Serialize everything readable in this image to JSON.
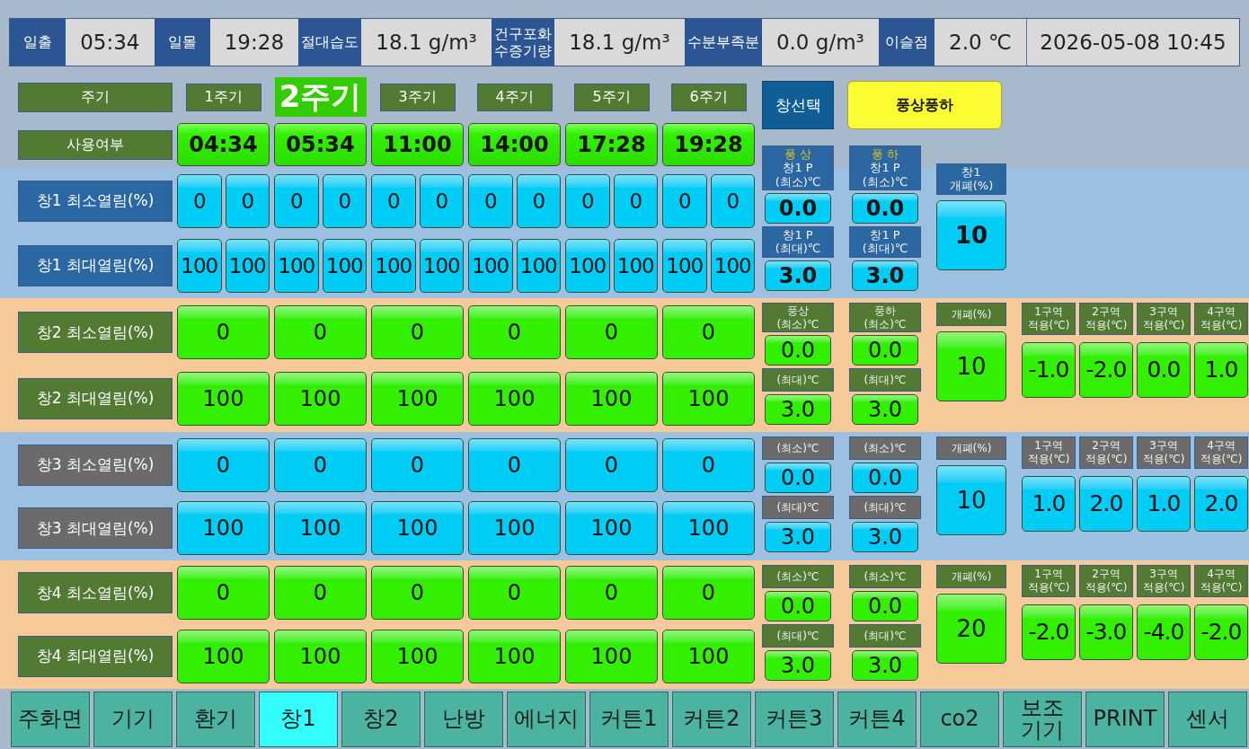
{
  "status_bar": {
    "items": [
      {
        "label": "일출",
        "value": "05:34"
      },
      {
        "label": "일몰",
        "value": "19:28"
      },
      {
        "label": "절대습도",
        "value": "18.1 g/m³"
      },
      {
        "label": "건구포화\n수증기량",
        "value": "18.1 g/m³"
      },
      {
        "label": "수분부족분",
        "value": "0.0 g/m³"
      },
      {
        "label": "이슬점",
        "value": "2.0 ℃"
      }
    ],
    "datetime": "2026-05-08 10:45"
  },
  "periods": {
    "header_label": "주기",
    "usage_label": "사용여부",
    "items": [
      {
        "label": "1주기",
        "time": "04:34",
        "selected": false
      },
      {
        "label": "2주기",
        "time": "05:34",
        "selected": true
      },
      {
        "label": "3주기",
        "time": "11:00",
        "selected": false
      },
      {
        "label": "4주기",
        "time": "14:00",
        "selected": false
      },
      {
        "label": "5주기",
        "time": "17:28",
        "selected": false
      },
      {
        "label": "6주기",
        "time": "19:28",
        "selected": false
      }
    ]
  },
  "window_select_button": "창선택",
  "wind_side_button": "풍상풍하",
  "windows": [
    {
      "kind": "split",
      "color": "#9bc0e1",
      "button": {
        "color": "#00cdf6"
      },
      "rows": [
        {
          "label": "창1 최소열림(%)",
          "color": "#2a67a3",
          "values": [
            "0",
            "0",
            "0",
            "0",
            "0",
            "0",
            "0",
            "0",
            "0",
            "0",
            "0",
            "0"
          ]
        },
        {
          "label": "창1 최대열림(%)",
          "color": "#2a67a3",
          "values": [
            "100",
            "100",
            "100",
            "100",
            "100",
            "100",
            "100",
            "100",
            "100",
            "100",
            "100",
            "100"
          ]
        }
      ],
      "pressure": [
        {
          "tag": "풍 상",
          "min_header": "창1 P\n(최소)℃",
          "min_value": "0.0",
          "max_header": "창1 P\n(최대)℃",
          "max_value": "3.0"
        },
        {
          "tag": "풍 하",
          "min_header": "창1 P\n(최소)℃",
          "min_value": "0.0",
          "max_header": "창1 P\n(최대)℃",
          "max_value": "3.0"
        }
      ],
      "opening": {
        "header": "창1\n개폐(%)",
        "value": "10"
      }
    },
    {
      "kind": "single",
      "color": "#f6c999",
      "button": {
        "color": "#33f000"
      },
      "rows": [
        {
          "label": "창2 최소열림(%)",
          "color": "#527a32",
          "values": [
            "0",
            "0",
            "0",
            "0",
            "0",
            "0"
          ]
        },
        {
          "label": "창2 최대열림(%)",
          "color": "#527a32",
          "values": [
            "100",
            "100",
            "100",
            "100",
            "100",
            "100"
          ]
        }
      ],
      "pressure": [
        {
          "min_header": "풍상\n(최소)℃",
          "min_value": "0.0",
          "max_header": "(최대)℃",
          "max_value": "3.0"
        },
        {
          "min_header": "풍하\n(최소)℃",
          "min_value": "0.0",
          "max_header": "(최대)℃",
          "max_value": "3.0"
        }
      ],
      "opening": {
        "header": "개폐(%)",
        "value": "10"
      },
      "zones": [
        {
          "header": "1구역\n적용(℃)",
          "value": "-1.0"
        },
        {
          "header": "2구역\n적용(℃)",
          "value": "-2.0"
        },
        {
          "header": "3구역\n적용(℃)",
          "value": "0.0"
        },
        {
          "header": "4구역\n적용(℃)",
          "value": "1.0"
        }
      ]
    },
    {
      "kind": "single",
      "color": "#9bc0e1",
      "button": {
        "color": "#00cdf6"
      },
      "rows": [
        {
          "label": "창3 최소열림(%)",
          "color": "#6b6b6b",
          "values": [
            "0",
            "0",
            "0",
            "0",
            "0",
            "0"
          ]
        },
        {
          "label": "창3 최대열림(%)",
          "color": "#6b6b6b",
          "values": [
            "100",
            "100",
            "100",
            "100",
            "100",
            "100"
          ]
        }
      ],
      "pressure": [
        {
          "min_header": "(최소)℃",
          "min_value": "0.0",
          "max_header": "(최대)℃",
          "max_value": "3.0"
        },
        {
          "min_header": "(최소)℃",
          "min_value": "0.0",
          "max_header": "(최대)℃",
          "max_value": "3.0"
        }
      ],
      "opening": {
        "header": "개폐(%)",
        "value": "10"
      },
      "zones": [
        {
          "header": "1구역\n적용(℃)",
          "value": "1.0"
        },
        {
          "header": "2구역\n적용(℃)",
          "value": "2.0"
        },
        {
          "header": "3구역\n적용(℃)",
          "value": "1.0"
        },
        {
          "header": "4구역\n적용(℃)",
          "value": "2.0"
        }
      ]
    },
    {
      "kind": "single",
      "color": "#f6c999",
      "button": {
        "color": "#33f000"
      },
      "rows": [
        {
          "label": "창4 최소열림(%)",
          "color": "#527a32",
          "values": [
            "0",
            "0",
            "0",
            "0",
            "0",
            "0"
          ]
        },
        {
          "label": "창4 최대열림(%)",
          "color": "#527a32",
          "values": [
            "100",
            "100",
            "100",
            "100",
            "100",
            "100"
          ]
        }
      ],
      "pressure": [
        {
          "min_header": "(최소)℃",
          "min_value": "0.0",
          "max_header": "(최대)℃",
          "max_value": "3.0"
        },
        {
          "min_header": "(최소)℃",
          "min_value": "0.0",
          "max_header": "(최대)℃",
          "max_value": "3.0"
        }
      ],
      "opening": {
        "header": "개폐(%)",
        "value": "20"
      },
      "zones": [
        {
          "header": "1구역\n적용(℃)",
          "value": "-2.0"
        },
        {
          "header": "2구역\n적용(℃)",
          "value": "-3.0"
        },
        {
          "header": "3구역\n적용(℃)",
          "value": "-4.0"
        },
        {
          "header": "4구역\n적용(℃)",
          "value": "-2.0"
        }
      ]
    }
  ],
  "nav_tabs": [
    {
      "label": "주화면",
      "selected": false
    },
    {
      "label": "기기",
      "selected": false
    },
    {
      "label": "환기",
      "selected": false
    },
    {
      "label": "창1",
      "selected": true
    },
    {
      "label": "창2",
      "selected": false
    },
    {
      "label": "난방",
      "selected": false
    },
    {
      "label": "에너지",
      "selected": false
    },
    {
      "label": "커튼1",
      "selected": false
    },
    {
      "label": "커튼2",
      "selected": false
    },
    {
      "label": "커튼3",
      "selected": false
    },
    {
      "label": "커튼4",
      "selected": false
    },
    {
      "label": "co2",
      "selected": false
    },
    {
      "label": "보조\n기기",
      "selected": false
    },
    {
      "label": "PRINT",
      "selected": false
    },
    {
      "label": "센서",
      "selected": false
    }
  ]
}
